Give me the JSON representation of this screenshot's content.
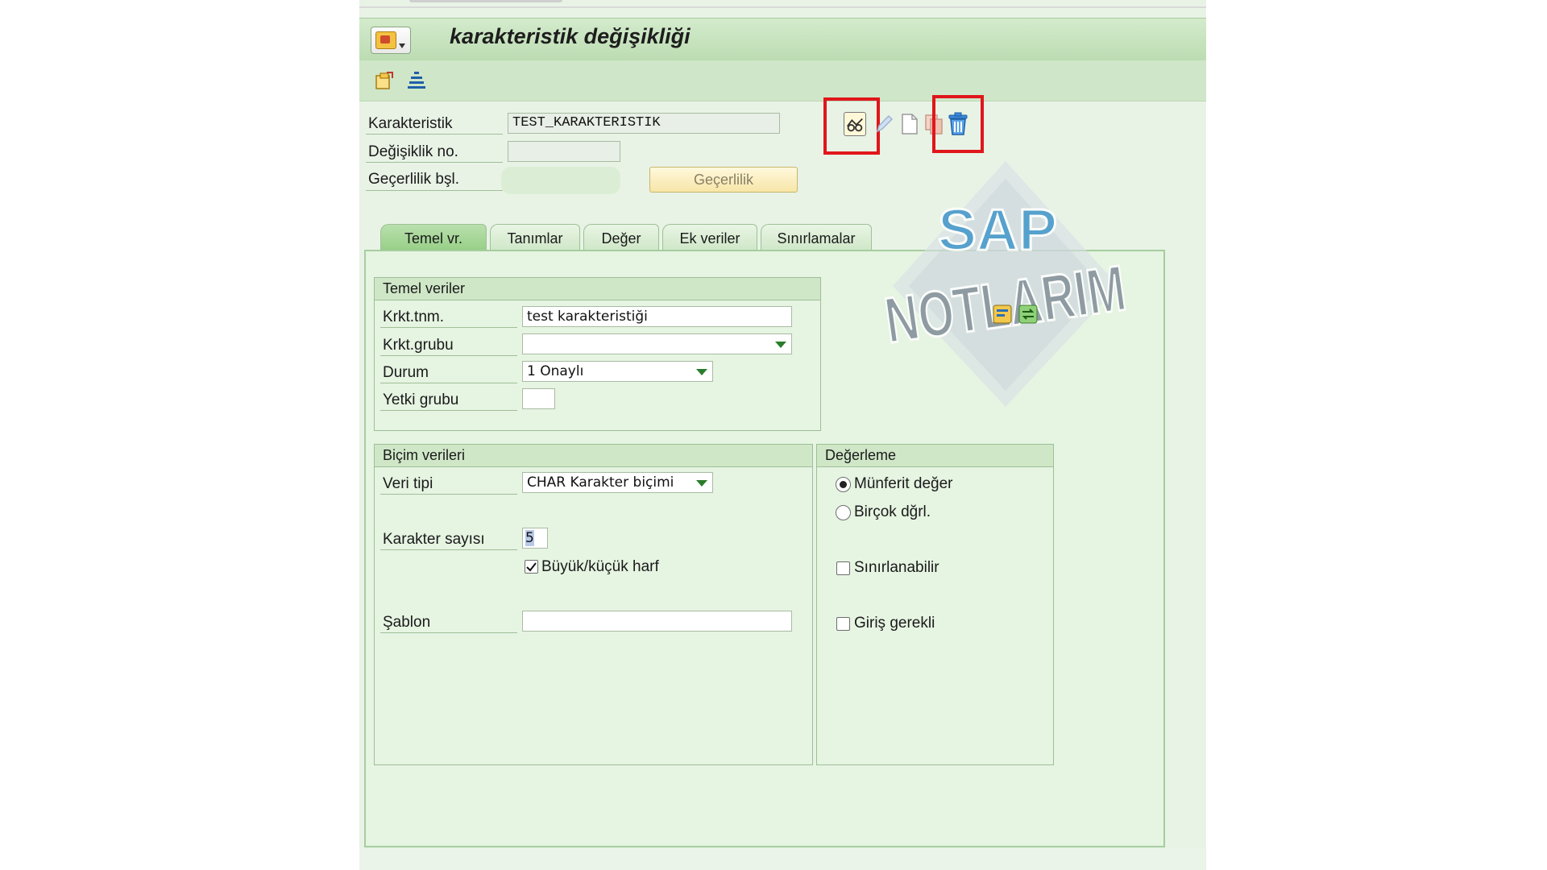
{
  "window": {
    "title": "karakteristik değişikliği"
  },
  "header": {
    "characteristic_label": "Karakteristik",
    "characteristic_value": "TEST_KARAKTERISTIK",
    "change_no_label": "Değişiklik no.",
    "change_no_value": "",
    "valid_from_label": "Geçerlilik bşl.",
    "valid_from_value": "",
    "validity_button": "Geçerlilik"
  },
  "tabs": [
    {
      "label": "Temel vr.",
      "active": true
    },
    {
      "label": "Tanımlar",
      "active": false
    },
    {
      "label": "Değer",
      "active": false
    },
    {
      "label": "Ek veriler",
      "active": false
    },
    {
      "label": "Sınırlamalar",
      "active": false
    }
  ],
  "basic_data": {
    "title": "Temel veriler",
    "description_label": "Krkt.tnm.",
    "description_value": "test karakteristiği",
    "group_label": "Krkt.grubu",
    "group_value": "",
    "status_label": "Durum",
    "status_value": "1 Onaylı",
    "auth_group_label": "Yetki grubu",
    "auth_group_value": ""
  },
  "format_data": {
    "title": "Biçim verileri",
    "data_type_label": "Veri tipi",
    "data_type_value": "CHAR Karakter biçimi",
    "num_chars_label": "Karakter sayısı",
    "num_chars_value": "5",
    "case_sensitive_label": "Büyük/küçük harf",
    "case_sensitive_checked": true,
    "template_label": "Şablon",
    "template_value": ""
  },
  "valuation": {
    "title": "Değerleme",
    "single_value_label": "Münferit değer",
    "single_value_selected": true,
    "multiple_values_label": "Birçok dğrl.",
    "restrictable_label": "Sınırlanabilir",
    "restrictable_checked": false,
    "entry_required_label": "Giriş gerekli",
    "entry_required_checked": false
  },
  "watermark": {
    "line1": "SAP",
    "line2": "NOTLARIM"
  },
  "colors": {
    "highlight": "#e0161b",
    "sap_green": "#bcdcb2",
    "panel": "#e6f4e2"
  }
}
